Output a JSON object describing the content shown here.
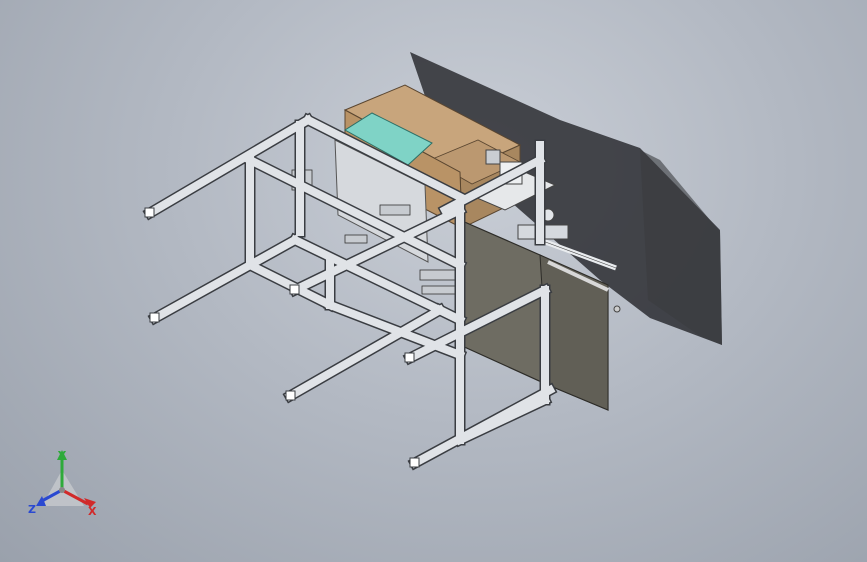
{
  "app": {
    "view": "isometric",
    "background_top": "#c9ced6",
    "background_bottom": "#9aa1ac"
  },
  "model": {
    "frame_color": "#dfe2e6",
    "frame_edge_color": "#3a3d42",
    "box_color": "#c8a57c",
    "panel_color": "#6e6c62",
    "shadow_color": "#2b2d31",
    "accent_color": "#7fd3c6"
  },
  "triad": {
    "y_label": "Y",
    "z_label": "Z",
    "x_label": "X",
    "colors": {
      "x": "#d12a2a",
      "y": "#2eaa3a",
      "z": "#2a49d1"
    },
    "icons": [
      "axis-triad-icon"
    ]
  }
}
